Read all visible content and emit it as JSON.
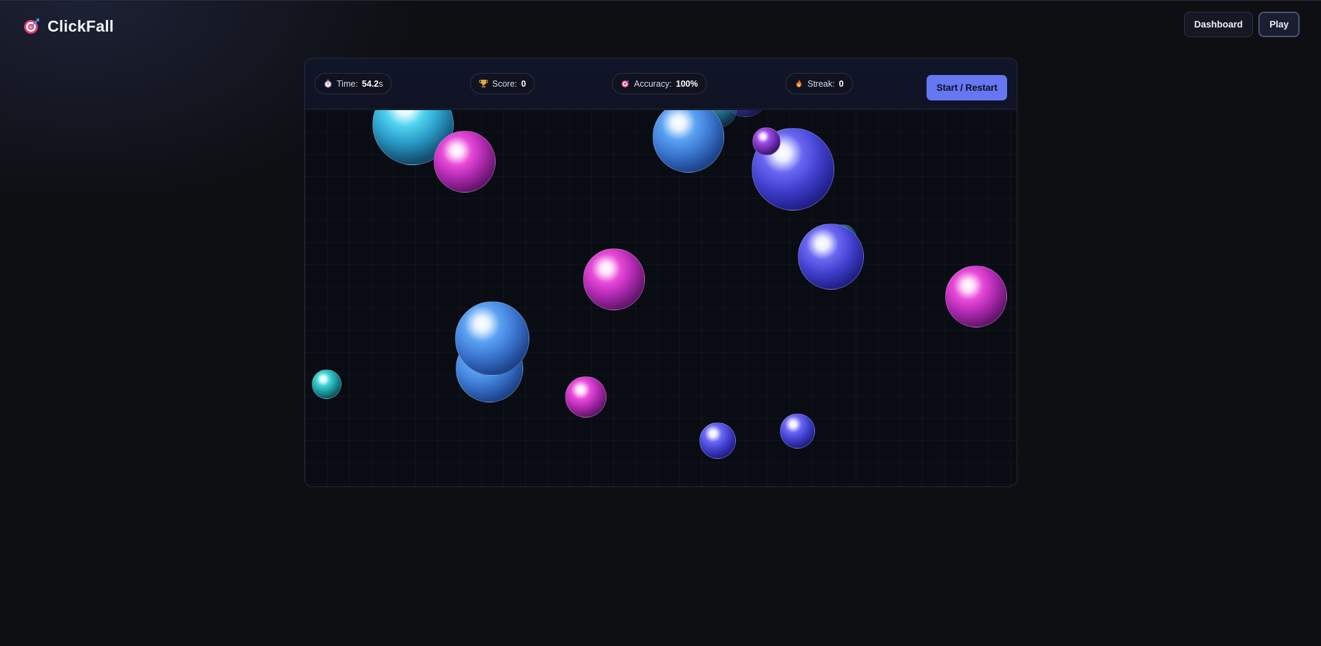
{
  "app": {
    "name": "ClickFall",
    "logo_icon": "target-dart-icon"
  },
  "nav": {
    "dashboard_label": "Dashboard",
    "play_label": "Play",
    "active": "Play"
  },
  "hud": {
    "time": {
      "label": "Time:",
      "value": "54.2",
      "unit": "s",
      "icon": "stopwatch-icon"
    },
    "score": {
      "label": "Score:",
      "value": "0",
      "icon": "trophy-icon"
    },
    "accuracy": {
      "label": "Accuracy:",
      "value": "100%",
      "icon": "target-icon"
    },
    "streak": {
      "label": "Streak:",
      "value": "0",
      "icon": "flame-icon"
    },
    "start_button_label": "Start / Restart"
  },
  "colors": {
    "accent": "#6677f3",
    "background": "#0e0f13",
    "orb_cyan": "#50d2f0",
    "orb_magenta": "#e84ad8",
    "orb_blue": "#5aa2f2",
    "orb_indigo": "#6a68f2",
    "orb_purple": "#a24ee6",
    "orb_teal": "#42d2d2"
  }
}
